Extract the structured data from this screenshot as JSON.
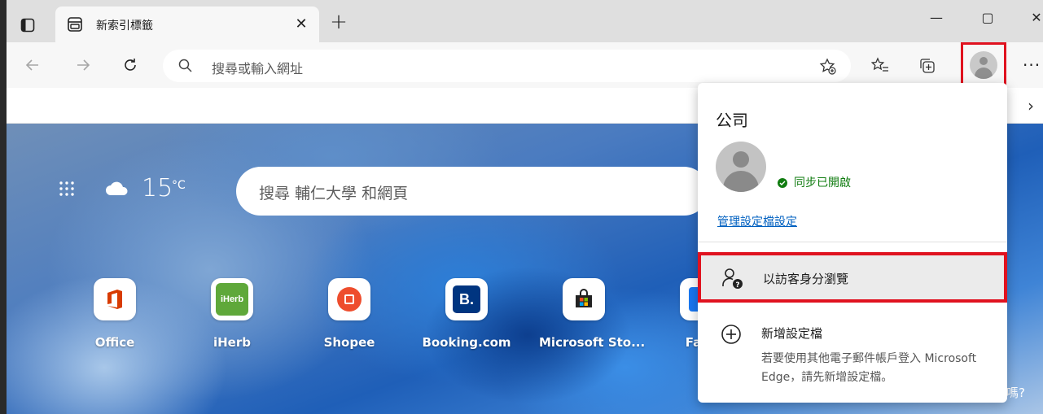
{
  "tab": {
    "title": "新索引標籤"
  },
  "window": {
    "minimize": "—",
    "maximize": "▢",
    "close": "✕"
  },
  "toolbar": {
    "address_placeholder": "搜尋或輸入網址",
    "more": "···"
  },
  "ntp": {
    "weather_temp": "15",
    "weather_unit": "°C",
    "search_placeholder": "搜尋 輔仁大學 和網頁",
    "tiles": [
      {
        "label": "Office",
        "icon": "office-icon",
        "color": "#d83b01"
      },
      {
        "label": "iHerb",
        "icon": "iherb-icon",
        "color": "#3a8e2f"
      },
      {
        "label": "Shopee",
        "icon": "shopee-icon",
        "color": "#ee4d2d"
      },
      {
        "label": "Booking.com",
        "icon": "booking-icon",
        "color": "#003580"
      },
      {
        "label": "Microsoft Sto...",
        "icon": "store-icon",
        "color": "#222222"
      },
      {
        "label": "Face",
        "icon": "facebook-icon",
        "color": "#1877f2"
      }
    ],
    "hint": "嗎?"
  },
  "flyout": {
    "org": "公司",
    "sync_status": "同步已開啟",
    "manage_link": "管理設定檔設定",
    "guest_label": "以訪客身分瀏覽",
    "add_label": "新增設定檔",
    "add_desc": "若要使用其他電子郵件帳戶登入 Microsoft Edge，請先新增設定檔。"
  },
  "colors": {
    "highlight": "#e0121f",
    "sync_green": "#107c10",
    "link": "#0060c0"
  }
}
